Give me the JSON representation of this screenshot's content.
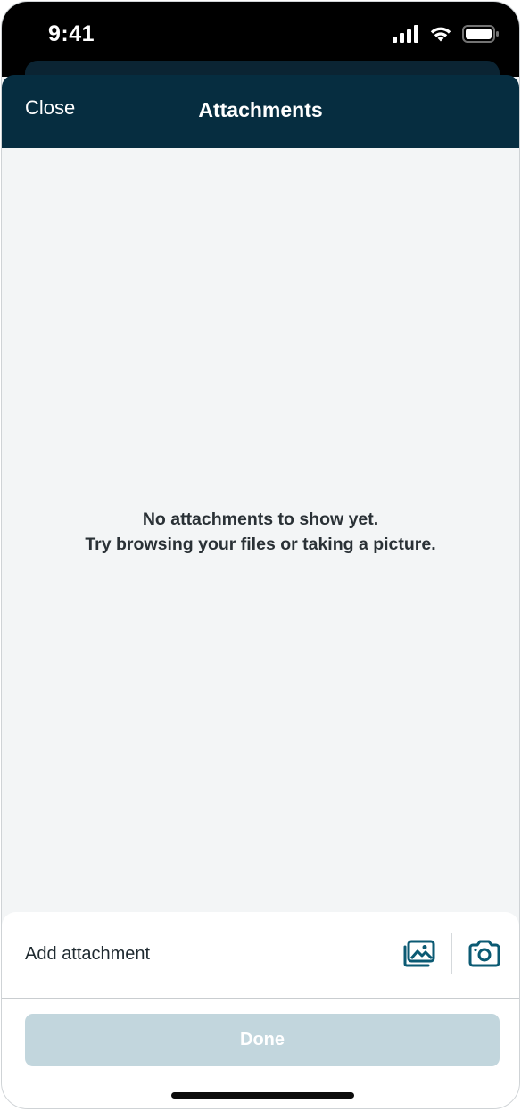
{
  "status_bar": {
    "time": "9:41",
    "icons": [
      "cellular-signal-icon",
      "wifi-icon",
      "battery-icon"
    ]
  },
  "nav": {
    "close_label": "Close",
    "title": "Attachments"
  },
  "empty_state": {
    "line1": "No attachments to show yet.",
    "line2": "Try browsing your files or taking a picture."
  },
  "attachment_bar": {
    "label": "Add attachment",
    "icons": [
      "photo-gallery-icon",
      "camera-icon"
    ]
  },
  "actions": {
    "done_label": "Done"
  },
  "colors": {
    "nav_background": "#062d40",
    "content_background": "#f3f5f6",
    "icon_accent": "#0b5a73",
    "done_disabled": "#c2d6dd"
  }
}
